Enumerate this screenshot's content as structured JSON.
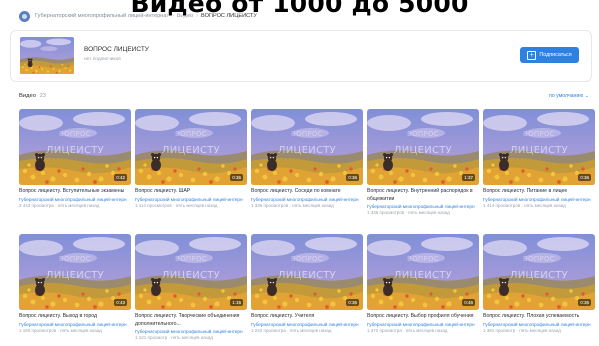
{
  "overlay": {
    "text": "Видео от 1000 до 5000"
  },
  "breadcrumb": {
    "community": "Губернаторский многопрофильный лицей-интернат",
    "section": "Видео",
    "current": "ВОПРОС ЛИЦЕИСТУ"
  },
  "header": {
    "title": "ВОПРОС ЛИЦЕИСТУ",
    "subtitle": "нет подписчиков",
    "subscribe_label": "Подписаться"
  },
  "section": {
    "title": "Видео",
    "count": "23",
    "sort_label": "по умолчанию ⌄"
  },
  "watermark": {
    "line1": "ВОПРОС",
    "line2": "ЛИЦЕИСТУ"
  },
  "videos": [
    {
      "title": "Вопрос лицеисту. Вступительные экзамены",
      "channel": "Губернаторский многопрофильный лицей-интерн",
      "meta": "3 443 просмотра · пять месяцев назад",
      "duration": "0:42"
    },
    {
      "title": "Вопрос лицеисту. ШАР",
      "channel": "Губернаторский многопрофильный лицей-интерн",
      "meta": "1 114 просмотров · пять месяцев назад",
      "duration": "0:36"
    },
    {
      "title": "Вопрос лицеисту. Соседи по комнате",
      "channel": "Губернаторский многопрофильный лицей-интерн",
      "meta": "1 336 просмотров · пять месяцев назад",
      "duration": "0:36"
    },
    {
      "title": "Вопрос лицеисту. Внутренний распорядок в общежитии",
      "channel": "Губернаторский многопрофильный лицей-интерн",
      "meta": "1 336 просмотров · пять месяцев назад",
      "duration": "1:37"
    },
    {
      "title": "Вопрос лицеисту. Питание в лицее",
      "channel": "Губернаторский многопрофильный лицей-интерн",
      "meta": "1 414 просмотров · пять месяцев назад",
      "duration": "0:36"
    },
    {
      "title": "Вопрос лицеисту. Выход в город",
      "channel": "Губернаторский многопрофильный лицей-интерн",
      "meta": "1 160 просмотров · пять месяцев назад",
      "duration": "0:43"
    },
    {
      "title": "Вопрос лицеисту. Творческие объединения дополнительного...",
      "channel": "Губернаторский многопрофильный лицей-интерн",
      "meta": "1 121 просмотр · пять месяцев назад",
      "duration": "1:15"
    },
    {
      "title": "Вопрос лицеисту. Учителя",
      "channel": "Губернаторский многопрофильный лицей-интерн",
      "meta": "1 222 просмотра · пять месяцев назад",
      "duration": "0:36"
    },
    {
      "title": "Вопрос лицеисту. Выбор профиля обучения",
      "channel": "Губернаторский многопрофильный лицей-интерн",
      "meta": "1 372 просмотра · пять месяцев назад",
      "duration": "0:46"
    },
    {
      "title": "Вопрос лицеисту. Плохая успеваемость",
      "channel": "Губернаторский многопрофильный лицей-интерн",
      "meta": "1 381 просмотр · пять месяцев назад",
      "duration": "0:36"
    }
  ],
  "colors": {
    "accent": "#2d81e0",
    "sky": "#8e8ad2",
    "field": "#d7a23a"
  },
  "icons": {
    "community_logo": "logo-icon",
    "subscribe": "plus-icon"
  }
}
